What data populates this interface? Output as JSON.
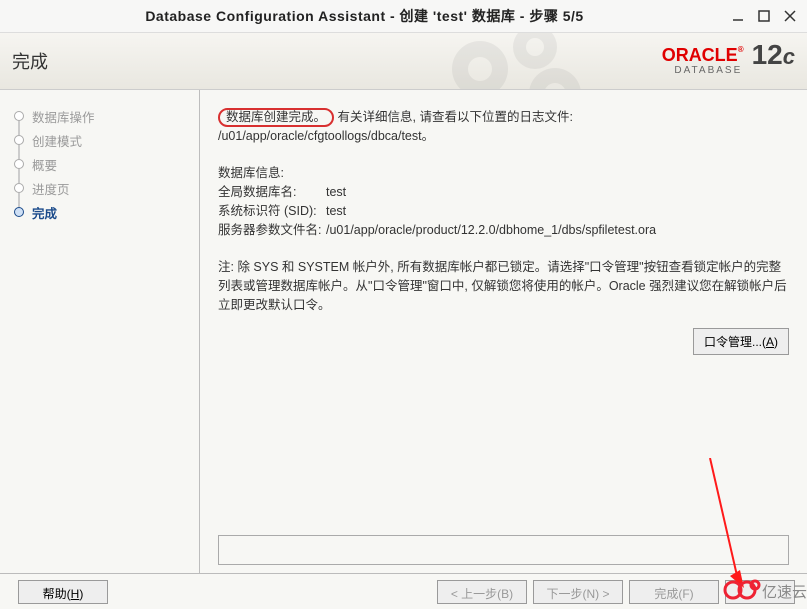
{
  "window": {
    "title": "Database Configuration Assistant - 创建 'test' 数据库 - 步骤 5/5"
  },
  "header": {
    "title": "完成",
    "brand_oracle": "ORACLE",
    "brand_db": "DATABASE",
    "brand_12": "12",
    "brand_c": "c"
  },
  "steps": [
    {
      "label": "数据库操作"
    },
    {
      "label": "创建模式"
    },
    {
      "label": "概要"
    },
    {
      "label": "进度页"
    },
    {
      "label": "完成",
      "current": true
    }
  ],
  "summary": {
    "created": "数据库创建完成。",
    "log_intro": "有关详细信息, 请查看以下位置的日志文件:",
    "log_path": "/u01/app/oracle/cfgtoollogs/dbca/test。",
    "info_title": "数据库信息:",
    "gdn_label": "全局数据库名:",
    "gdn_value": "test",
    "sid_label": "系统标识符 (SID):",
    "sid_value": "test",
    "spfile_label": "服务器参数文件名:",
    "spfile_value": "/u01/app/oracle/product/12.2.0/dbhome_1/dbs/spfiletest.ora",
    "note": "注: 除 SYS 和 SYSTEM 帐户外, 所有数据库帐户都已锁定。请选择\"口令管理\"按钮查看锁定帐户的完整列表或管理数据库帐户。从\"口令管理\"窗口中, 仅解锁您将使用的帐户。Oracle 强烈建议您在解锁帐户后立即更改默认口令。"
  },
  "buttons": {
    "pwd_label": "口令管理...(",
    "pwd_accel": "A",
    "pwd_close": ")",
    "help_label": "帮助(",
    "help_accel": "H",
    "help_close": ")",
    "back": "< 上一步(B)",
    "next": "下一步(N) >",
    "finish": "完成(F)"
  },
  "watermark": {
    "text": "亿速云"
  }
}
